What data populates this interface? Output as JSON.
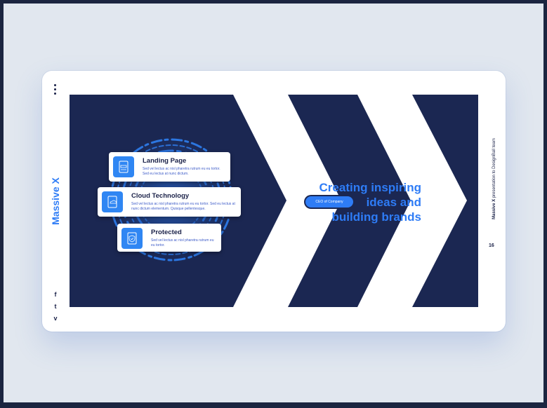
{
  "brand": "Massive X",
  "side_caption": {
    "brand": "Massive X",
    "rest": " presentation to DesignBall team"
  },
  "page_number": "16",
  "social": [
    "f",
    "t",
    "v"
  ],
  "features": [
    {
      "title": "Landing Page",
      "text": "Sed vel lectus ac nisl pharetra rutrum eu eu tortor. Sed eu lectus at nunc dictum."
    },
    {
      "title": "Cloud Technology",
      "text": "Sed vel lectus ac nisl pharetra rutrum eu eu tortor. Sed eu lectus at nunc dictum elementum. Quisque pellentesque."
    },
    {
      "title": "Protected",
      "text": "Sed vel lectus ac nisl pharetra rutrum eu eu tortor."
    }
  ],
  "headline": [
    "Creating inspiring",
    "ideas and",
    "building brands"
  ],
  "pill_label": "CEO of Company",
  "colors": {
    "accent": "#2e7cf6",
    "navy": "#1b2752",
    "background": "#e1e7ef"
  },
  "icons": [
    "menu-dots-icon",
    "facebook-icon",
    "twitter-icon",
    "vimeo-icon",
    "web-page-icon",
    "cloud-document-icon",
    "shield-document-icon"
  ]
}
